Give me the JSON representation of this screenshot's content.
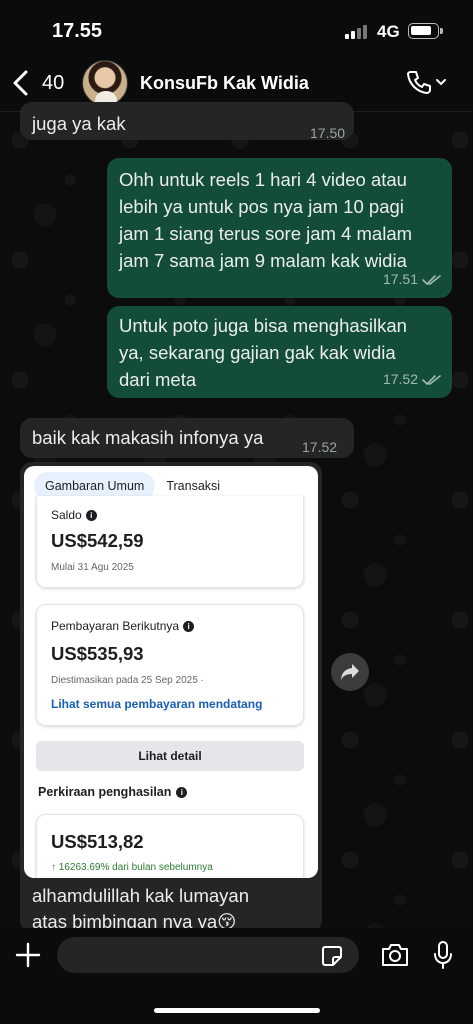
{
  "status": {
    "time": "17.55",
    "network": "4G"
  },
  "header": {
    "back_count": "40",
    "contact_name": "KonsuFb Kak Widia"
  },
  "messages": [
    {
      "direction": "in",
      "text": "juga ya kak",
      "time": "17.50"
    },
    {
      "direction": "out",
      "lines": [
        "Ohh untuk reels 1 hari 4 video atau",
        "lebih ya untuk pos nya jam 10 pagi",
        "jam 1 siang terus sore jam 4 malam",
        "jam 7 sama jam 9 malam kak widia"
      ],
      "time": "17.51",
      "status": "read"
    },
    {
      "direction": "out",
      "lines": [
        "Untuk poto juga bisa menghasilkan",
        "ya, sekarang gajian gak kak widia",
        "dari meta"
      ],
      "time": "17.52",
      "status": "read"
    },
    {
      "direction": "in",
      "text": "baik kak makasih infonya ya",
      "time": "17.52"
    }
  ],
  "image_message": {
    "tabs": [
      "Gambaran Umum",
      "Transaksi"
    ],
    "active_tab": "Gambaran Umum",
    "saldo": {
      "label": "Saldo",
      "amount": "US$542,59",
      "sub": "Mulai 31 Agu 2025"
    },
    "next_payment": {
      "label": "Pembayaran Berikutnya",
      "amount": "US$535,93",
      "sub": "Diestimasikan pada 25 Sep 2025 ·",
      "link": "Lihat semua pembayaran mendatang"
    },
    "detail_button": "Lihat detail",
    "earnings": {
      "title": "Perkiraan penghasilan",
      "amount": "US$513,82",
      "growth": "↑ 16263.69% dari bulan sebelumnya"
    },
    "caption_lines": [
      "alhamdulillah kak lumayan",
      "atas bimbingan nya ya😚"
    ]
  },
  "colors": {
    "incoming": "#242626",
    "outgoing": "#144d37",
    "link": "#1a5fb4",
    "growth": "#2e7d32"
  },
  "icons": [
    "back-icon",
    "phone-icon",
    "chevron-down-icon",
    "forward-icon",
    "plus-icon",
    "sticker-icon",
    "camera-icon",
    "microphone-icon",
    "double-check-icon",
    "info-icon"
  ]
}
